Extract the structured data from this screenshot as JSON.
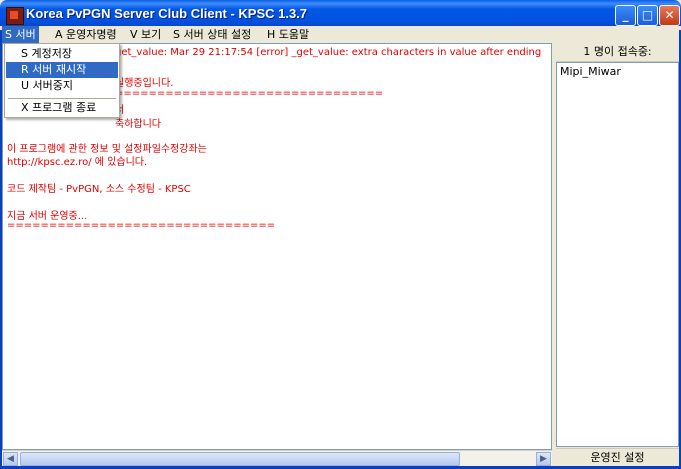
{
  "window": {
    "title": "Korea PvPGN Server Club Client - KPSC 1.3.7"
  },
  "menubar": {
    "items": [
      "S 서버",
      "A 운영자명령",
      "V 보기",
      "S 서버 상태 설정",
      "H 도움말"
    ]
  },
  "server_menu": {
    "items": [
      "S 계정저장",
      "R 서버 재시작",
      "U 서버중지",
      "X 프로그램 종료"
    ]
  },
  "log": {
    "lines": [
      "get_value: Mar 29 21:17:54 [error] _get_value: extra characters in value after ending",
      "실행중입니다.",
      "================================",
      "서",
      "축하합니다",
      "이 프로그램에 관한 정보 및 설정파일수정강좌는",
      "http://kpsc.ez.ro/ 에 있습니다.",
      "코드 제작팀 - PvPGN, 소스 수정팀 - KPSC",
      "지금 서버 운영중...",
      "================================"
    ]
  },
  "users_panel": {
    "header": "1 명이 접속중:",
    "users": [
      "Mipi_Miwar"
    ],
    "footer": "운영진 설정"
  },
  "colors": {
    "log_text": "#E00000",
    "menu_highlight": "#316AC5"
  }
}
